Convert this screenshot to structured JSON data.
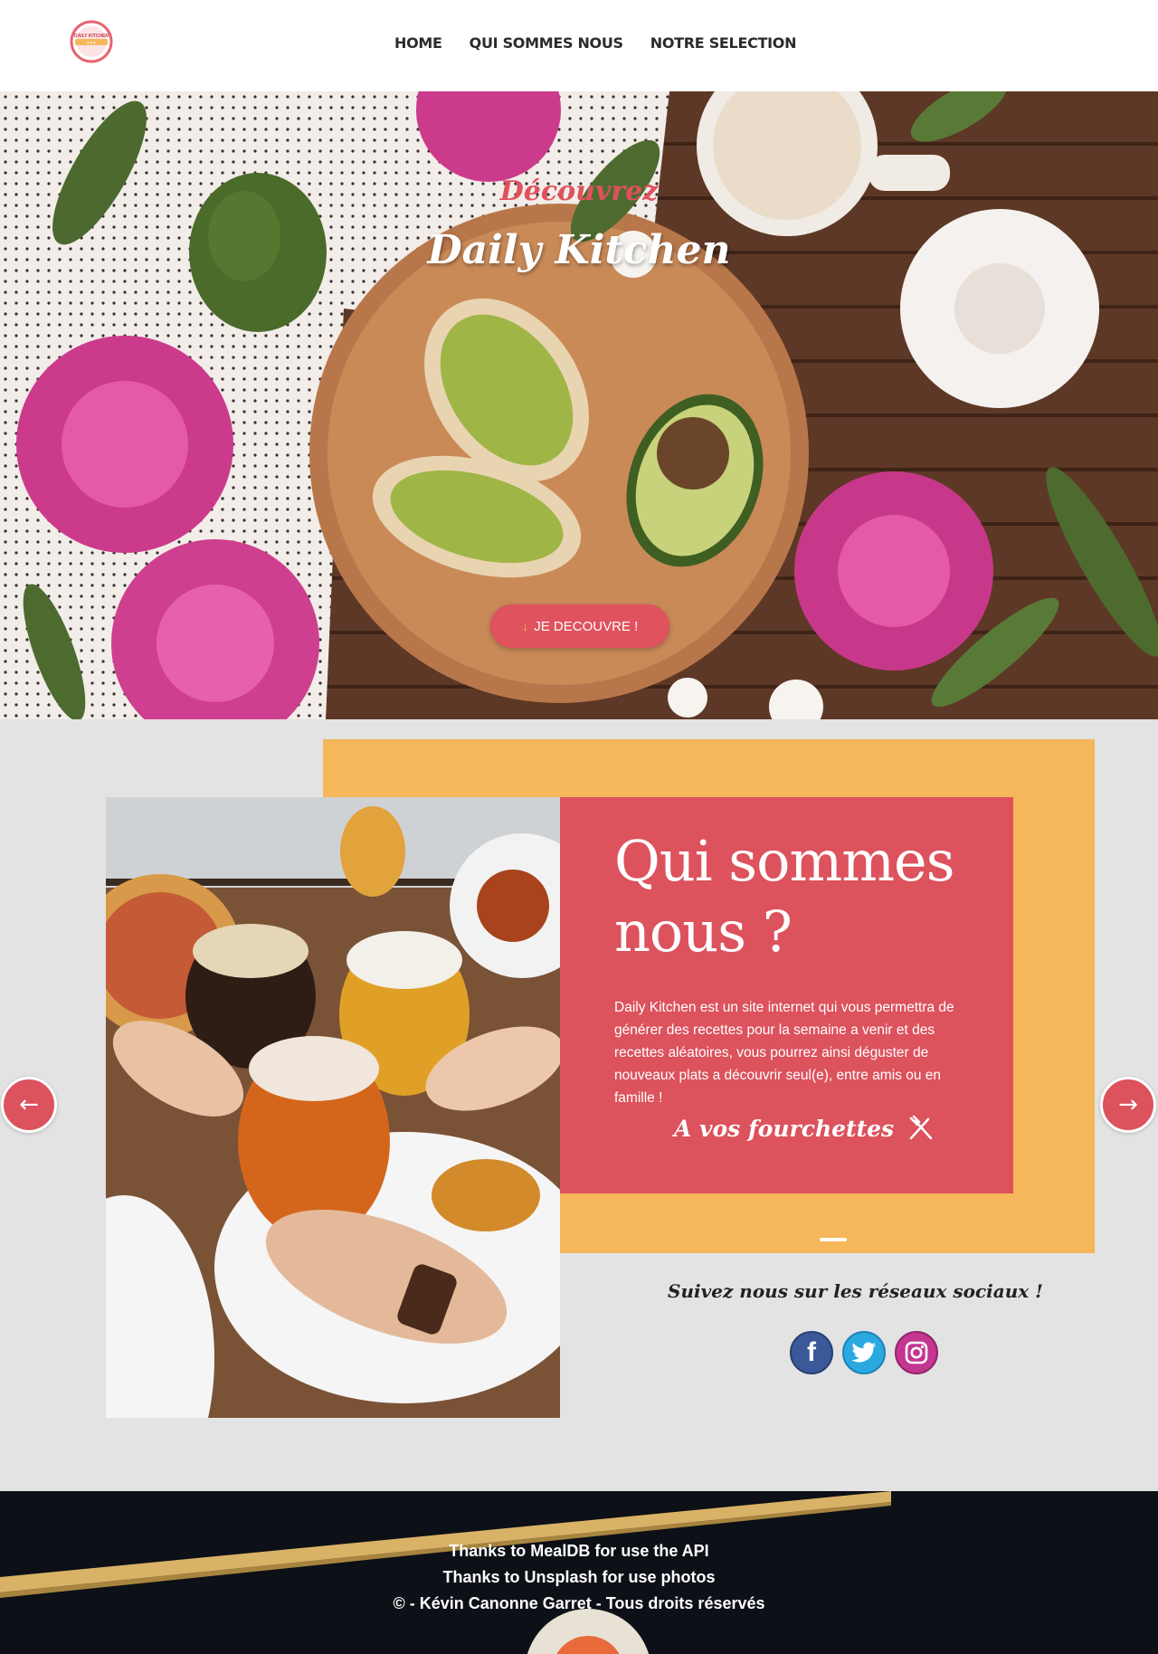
{
  "header": {
    "logo_alt": "DAILY KITCHEN",
    "nav": [
      {
        "label": "HOME"
      },
      {
        "label": "QUI SOMMES NOUS"
      },
      {
        "label": "NOTRE SELECTION"
      }
    ]
  },
  "hero": {
    "subtitle": "Découvrez",
    "title": "Daily Kitchen",
    "button_icon": "↓",
    "button_label": "JE DECOUVRE !"
  },
  "about": {
    "heading": "Qui sommes nous ?",
    "body": "Daily Kitchen est un site internet qui vous permettra de générer des recettes pour la semaine a venir et des recettes aléatoires, vous pourrez ainsi déguster de nouveaux plats a découvrir seul(e), entre amis ou en famille !",
    "tagline": "A vos fourchettes",
    "follow_label": "Suivez nous sur les réseaux sociaux !",
    "socials": [
      {
        "name": "facebook-icon",
        "glyph": "f"
      },
      {
        "name": "twitter-icon",
        "glyph": ""
      },
      {
        "name": "instagram-icon",
        "glyph": ""
      }
    ]
  },
  "carousel": {
    "prev_glyph": "←",
    "next_glyph": "→"
  },
  "footer": {
    "line1": "Thanks to MealDB for use the API",
    "line2": "Thanks to Unsplash for use photos",
    "line3": "© - Kévin Canonne Garret -  Tous droits réservés"
  },
  "colors": {
    "brand_red": "#dc525d",
    "brand_yellow": "#f5b75a",
    "background_gray": "#e3e3e3",
    "footer_dark": "#0d1016"
  }
}
